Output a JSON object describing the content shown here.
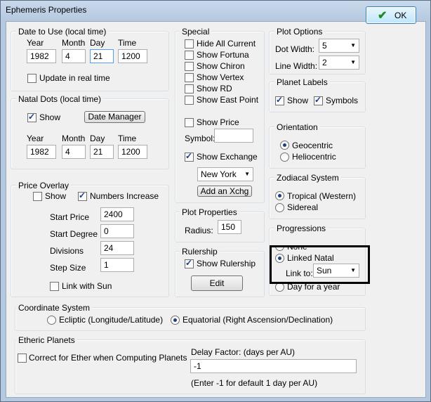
{
  "window": {
    "title": "Ephemeris Properties"
  },
  "ok_button": "OK",
  "date_to_use": {
    "title": "Date to Use (local time)",
    "year_label": "Year",
    "month_label": "Month",
    "day_label": "Day",
    "time_label": "Time",
    "year": "1982",
    "month": "4",
    "day": "21",
    "time": "1200",
    "update_label": "Update in real time"
  },
  "natal_dots": {
    "title": "Natal Dots (local time)",
    "show_label": "Show",
    "date_manager": "Date Manager",
    "year_label": "Year",
    "month_label": "Month",
    "day_label": "Day",
    "time_label": "Time",
    "year": "1982",
    "month": "4",
    "day": "21",
    "time": "1200"
  },
  "price_overlay": {
    "title": "Price Overlay",
    "show_label": "Show",
    "numbers_increase_label": "Numbers Increase",
    "start_price_label": "Start Price",
    "start_price": "2400",
    "start_degree_label": "Start Degree",
    "start_degree": "0",
    "divisions_label": "Divisions",
    "divisions": "24",
    "step_size_label": "Step Size",
    "step_size": "1",
    "link_sun_label": "Link with Sun"
  },
  "special": {
    "title": "Special",
    "items": [
      "Hide All Current",
      "Show Fortuna",
      "Show Chiron",
      "Show Vertex",
      "Show RD",
      "Show East Point"
    ],
    "show_price_label": "Show Price",
    "symbol_label": "Symbol:",
    "symbol_value": "",
    "show_exchange_label": "Show Exchange",
    "exchange_selected": "New York",
    "add_xchg": "Add an Xchg"
  },
  "plot_properties": {
    "title": "Plot Properties",
    "radius_label": "Radius:",
    "radius": "150"
  },
  "rulership": {
    "title": "Rulership",
    "show_label": "Show Rulership",
    "edit": "Edit"
  },
  "plot_options": {
    "title": "Plot Options",
    "dot_width_label": "Dot Width:",
    "dot_width": "5",
    "line_width_label": "Line Width:",
    "line_width": "2"
  },
  "planet_labels": {
    "title": "Planet Labels",
    "show_label": "Show",
    "symbols_label": "Symbols"
  },
  "orientation": {
    "title": "Orientation",
    "geocentric": "Geocentric",
    "heliocentric": "Heliocentric"
  },
  "zodiacal": {
    "title": "Zodiacal System",
    "tropical": "Tropical (Western)",
    "sidereal": "Sidereal"
  },
  "progressions": {
    "title": "Progressions",
    "none": "None",
    "linked_natal": "Linked Natal",
    "link_to_label": "Link to:",
    "link_to": "Sun",
    "day_for_year": "Day for a year"
  },
  "coordinate": {
    "title": "Coordinate System",
    "ecliptic": "Ecliptic (Longitude/Latitude)",
    "equatorial": "Equatorial (Right Ascension/Declination)"
  },
  "etheric": {
    "title": "Etheric Planets",
    "correct_label": "Correct for Ether when Computing Planets",
    "delay_label": "Delay Factor: (days per AU)",
    "delay_value": "-1",
    "hint": "(Enter -1 for default 1 day per AU)"
  }
}
